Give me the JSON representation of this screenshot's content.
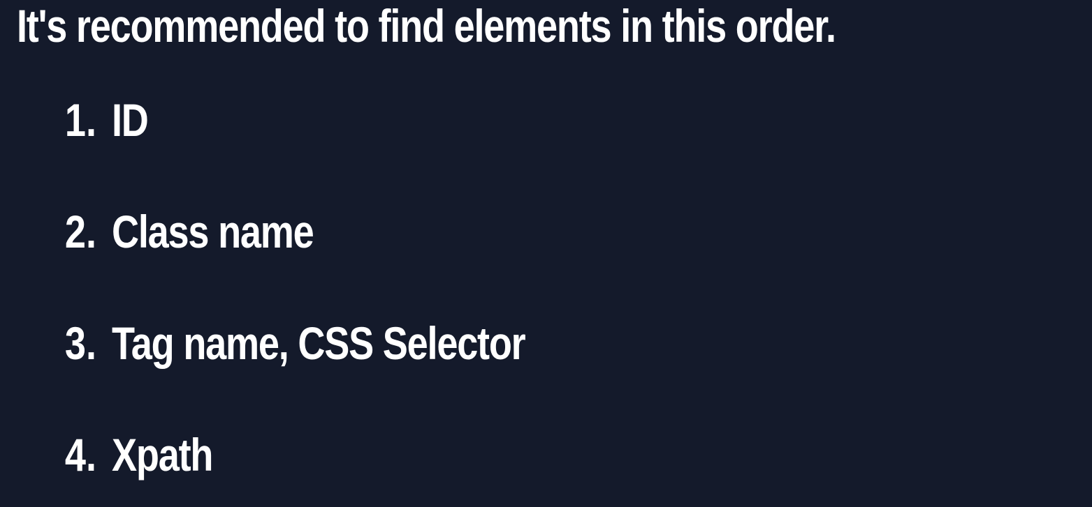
{
  "heading": "It's recommended to find elements in this order.",
  "items": [
    {
      "number": "1.",
      "label": "ID"
    },
    {
      "number": "2.",
      "label": "Class name"
    },
    {
      "number": "3.",
      "label": "Tag name, CSS Selector"
    },
    {
      "number": "4.",
      "label": "Xpath"
    }
  ],
  "colors": {
    "background": "#141a2b",
    "text": "#ffffff"
  }
}
